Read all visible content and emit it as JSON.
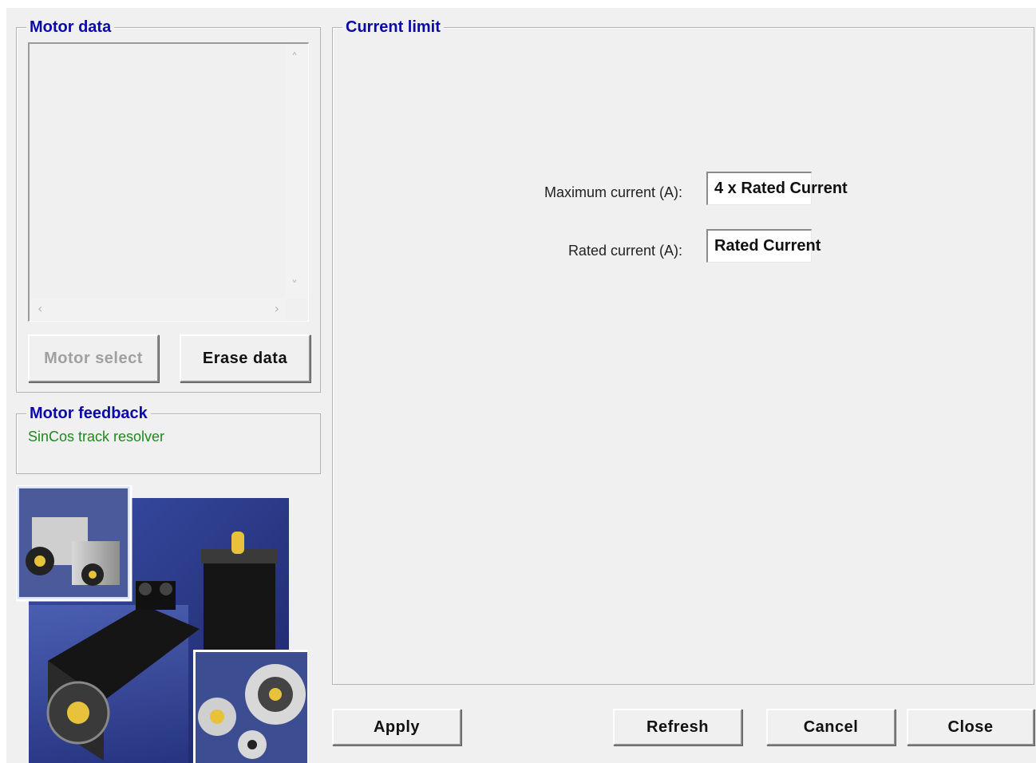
{
  "motor_data": {
    "title": "Motor data",
    "motor_select_label": "Motor select",
    "erase_data_label": "Erase data"
  },
  "motor_feedback": {
    "title": "Motor feedback",
    "value": "SinCos track resolver"
  },
  "current_limit": {
    "title": "Current limit",
    "max_current_label": "Maximum current (A):",
    "max_current_value": "4 x Rated Current",
    "rated_current_label": "Rated current (A):",
    "rated_current_value": "Rated Current"
  },
  "buttons": {
    "apply": "Apply",
    "refresh": "Refresh",
    "cancel": "Cancel",
    "close": "Close"
  },
  "icons": {
    "scroll_up": "chevron-up-icon",
    "scroll_down": "chevron-down-icon",
    "scroll_left": "chevron-left-icon",
    "scroll_right": "chevron-right-icon"
  },
  "colors": {
    "group_title": "#0a0aa8",
    "feedback_text": "#1d8a1d",
    "background": "#f0f0f0"
  }
}
